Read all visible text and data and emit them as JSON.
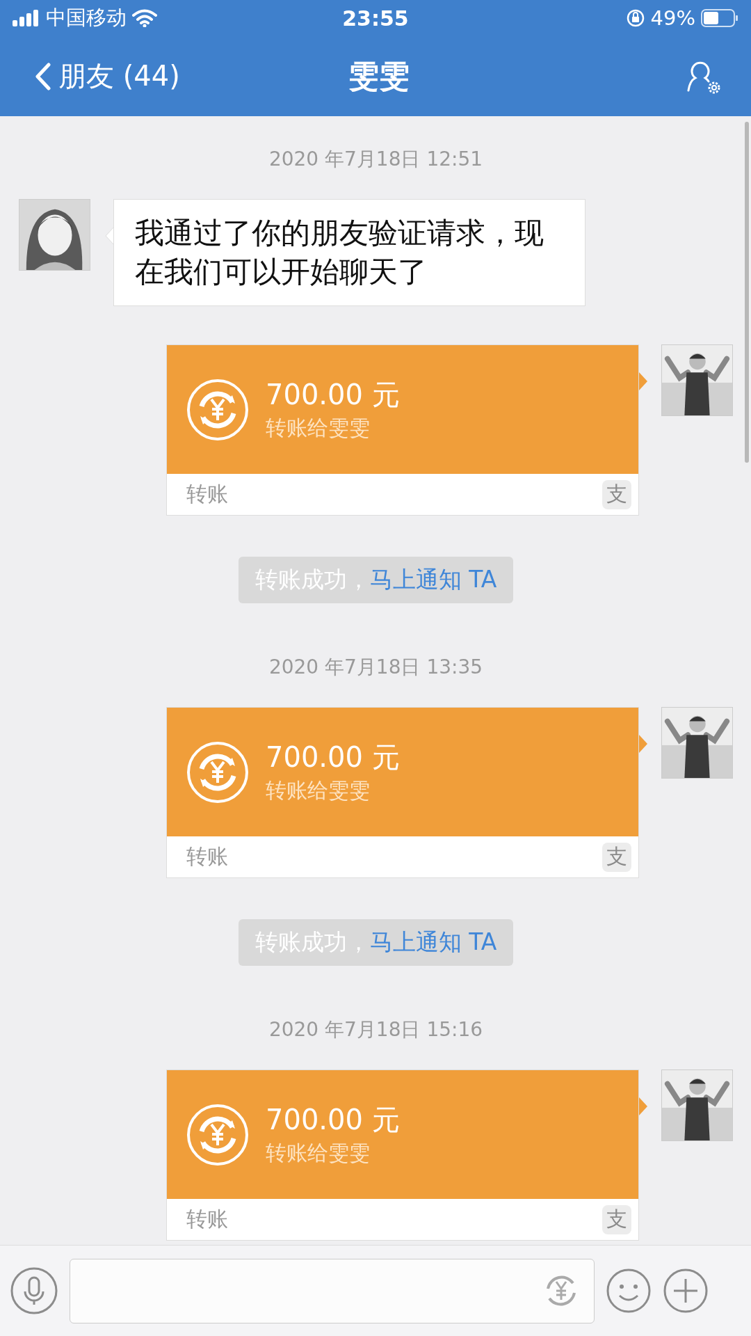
{
  "status_bar": {
    "carrier": "中国移动",
    "time": "23:55",
    "battery": "49%"
  },
  "nav": {
    "back_label": "朋友 (44)",
    "title": "雯雯"
  },
  "messages": [
    {
      "kind": "timestamp",
      "text": "2020 年7月18日 12:51"
    },
    {
      "kind": "text",
      "text": "我通过了你的朋友验证请求，现在我们可以开始聊天了"
    },
    {
      "kind": "transfer",
      "amount": "700.00 元",
      "note": "转账给雯雯",
      "footer": "转账",
      "badge": "支"
    },
    {
      "kind": "notice",
      "text": "转账成功，",
      "link": "马上通知 TA"
    },
    {
      "kind": "timestamp",
      "text": "2020 年7月18日 13:35"
    },
    {
      "kind": "transfer",
      "amount": "700.00 元",
      "note": "转账给雯雯",
      "footer": "转账",
      "badge": "支"
    },
    {
      "kind": "notice",
      "text": "转账成功，",
      "link": "马上通知 TA"
    },
    {
      "kind": "timestamp",
      "text": "2020 年7月18日 15:16"
    },
    {
      "kind": "transfer",
      "amount": "700.00 元",
      "note": "转账给雯雯",
      "footer": "转账",
      "badge": "支"
    }
  ],
  "input": {
    "kind": "text-field"
  }
}
